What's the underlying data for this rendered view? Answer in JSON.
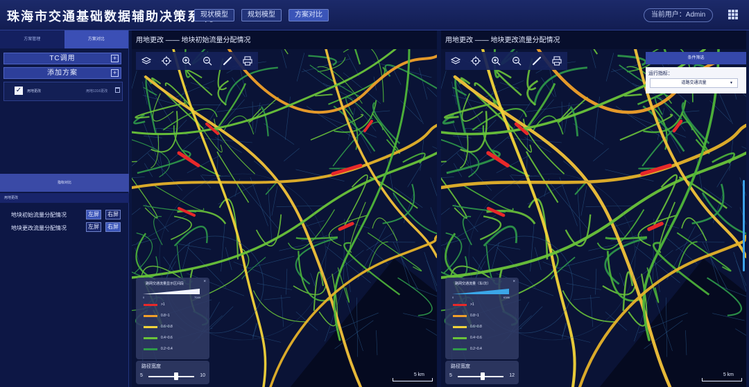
{
  "header": {
    "title": "珠海市交通基础数据辅助决策系统",
    "nav": [
      "现状模型",
      "规划模型",
      "方案对比"
    ],
    "user": "当前用户：Admin"
  },
  "sidebar": {
    "tabs": [
      "方案管理",
      "方案对比"
    ],
    "tc_call": "TC调用",
    "add_scheme": "添加方案",
    "scheme_name": "用地更改",
    "scheme_meta": "用地1316更改",
    "compare_bar": "指标对比",
    "compare_sub": "用地更改",
    "rows": [
      {
        "label": "地块初始流量分配情况",
        "left": "左屏",
        "right": "右屏"
      },
      {
        "label": "地块更改流量分配情况",
        "left": "左屏",
        "right": "右屏"
      }
    ]
  },
  "left_panel": {
    "title": "用地更改 —— 地块初始流量分配情况",
    "legend_title": "路网交通流量显示区间段",
    "scale_lo": "0",
    "scale_hi": "7044",
    "width_title": "路径宽度",
    "width_min": "5",
    "width_max": "10",
    "width_value": 0.6,
    "scale_text": "5 km"
  },
  "right_panel": {
    "title": "用地更改 —— 地块更改流量分配情况",
    "legend_title": "路网交通流量（车/次）",
    "scale_lo": "0",
    "scale_hi": "6386",
    "width_title": "路径宽度",
    "width_min": "5",
    "width_max": "12",
    "width_value": 0.55,
    "scale_text": "5 km",
    "cond_head": "条件筛选",
    "cond_label": "运行指标：",
    "cond_value": "道路交通流量"
  },
  "legend_items": [
    {
      "label": ">1",
      "color": "#e8282a"
    },
    {
      "label": "0.8~1",
      "color": "#f0a02a"
    },
    {
      "label": "0.6~0.8",
      "color": "#f2d33a"
    },
    {
      "label": "0.4~0.6",
      "color": "#6ac33a"
    },
    {
      "label": "0.2~0.4",
      "color": "#2f9a4a"
    }
  ],
  "colors": {
    "accent": "#3b55b8",
    "background": "#0b1640",
    "scroll": "#3ba0e8"
  },
  "toolbar_icons": [
    "layers-icon",
    "locate-icon",
    "zoom-in-icon",
    "zoom-out-icon",
    "measure-icon",
    "print-icon"
  ]
}
